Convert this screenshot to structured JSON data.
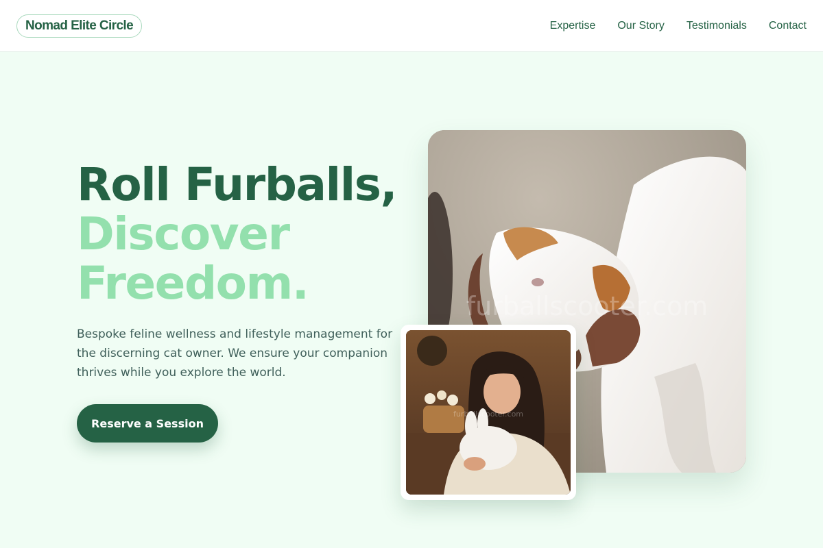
{
  "header": {
    "logo": "Nomad Elite Circle",
    "nav": [
      {
        "label": "Expertise"
      },
      {
        "label": "Our Story"
      },
      {
        "label": "Testimonials"
      },
      {
        "label": "Contact"
      }
    ]
  },
  "hero": {
    "title_line1": "Roll Furballs,",
    "title_line2": "Discover",
    "title_line3": "Freedom.",
    "lead": "Bespoke feline wellness and lifestyle management for the discerning cat owner. We ensure your companion thrives while you explore the world.",
    "cta_label": "Reserve a Session",
    "main_photo": {
      "alt": "White puppy with brown ears being held by hands",
      "watermark": "furballscooter.com"
    },
    "small_photo": {
      "alt": "Woman hugging a white fluffy rabbit",
      "watermark": "furballscooter.com"
    }
  },
  "colors": {
    "brand_dark": "#256245",
    "brand_light": "#93e0ad",
    "page_bg": "#f0fdf4"
  }
}
